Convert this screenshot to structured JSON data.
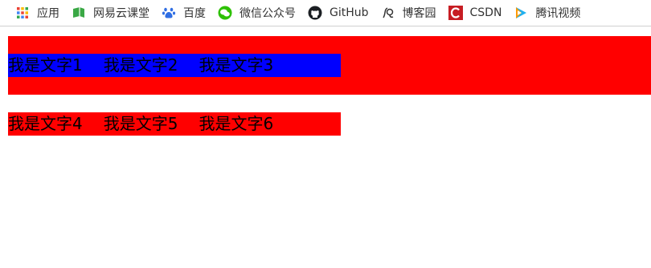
{
  "bookmarks": [
    {
      "label": "应用",
      "icon": "apps-grid-icon"
    },
    {
      "label": "网易云课堂",
      "icon": "netease-study-icon"
    },
    {
      "label": "百度",
      "icon": "baidu-paw-icon"
    },
    {
      "label": "微信公众号",
      "icon": "wechat-icon"
    },
    {
      "label": "GitHub",
      "icon": "github-icon"
    },
    {
      "label": "博客园",
      "icon": "cnblogs-icon"
    },
    {
      "label": "CSDN",
      "icon": "csdn-icon"
    },
    {
      "label": "腾讯视频",
      "icon": "tencent-video-icon"
    }
  ],
  "demo": {
    "block1": {
      "texts": [
        "我是文字1",
        "我是文字2",
        "我是文字3"
      ],
      "outer_color": "#ff0000",
      "inner_color": "#0000ff"
    },
    "block2": {
      "texts": [
        "我是文字4",
        "我是文字5",
        "我是文字6"
      ],
      "color": "#ff0000"
    }
  }
}
